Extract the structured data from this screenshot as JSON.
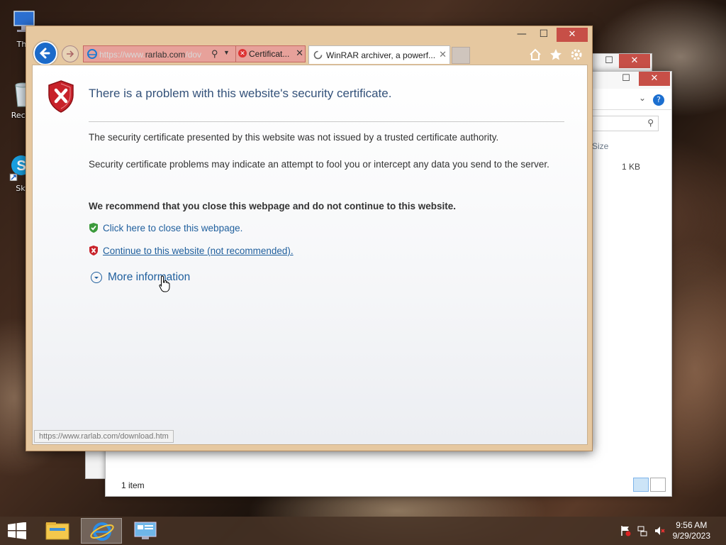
{
  "desktop": {
    "icons": [
      {
        "label": "Thi",
        "name": "this-pc"
      },
      {
        "label": "Recyc",
        "name": "recycle-bin"
      },
      {
        "label": "Sky",
        "name": "skype"
      }
    ]
  },
  "explorer": {
    "column_size": "Size",
    "file_size": "1 KB",
    "status": "1 item",
    "minimize": "—",
    "maximize": "☐",
    "close": "✕"
  },
  "ie": {
    "minimize": "—",
    "maximize": "☐",
    "close": "✕",
    "address": {
      "url_prefix": "https://www.",
      "url_host": "rarlab.com",
      "url_suffix": "/dov"
    },
    "tabs": [
      {
        "label": "Certificat..."
      },
      {
        "label": "WinRAR archiver, a powerf..."
      }
    ],
    "toolbar_icons": [
      "home-icon",
      "star-icon",
      "gear-icon"
    ],
    "page": {
      "title": "There is a problem with this website's security certificate.",
      "para1": "The security certificate presented by this website was not issued by a trusted certificate authority.",
      "para2": "Security certificate problems may indicate an attempt to fool you or intercept any data you send to the server.",
      "recommend": "We recommend that you close this webpage and do not continue to this website.",
      "close_link": "Click here to close this webpage.",
      "continue_link": "Continue to this website (not recommended).",
      "more_info": "More information"
    },
    "status_url": "https://www.rarlab.com/download.htm"
  },
  "taskbar": {
    "items": [
      "file-explorer",
      "internet-explorer",
      "control-panel"
    ],
    "time": "9:56 AM",
    "date": "9/29/2023"
  },
  "colors": {
    "link": "#1f5f9d",
    "title": "#34527a",
    "address_error": "#e7a19a",
    "close_button": "#c74f47",
    "ie_frame": "#e6c8a0"
  }
}
